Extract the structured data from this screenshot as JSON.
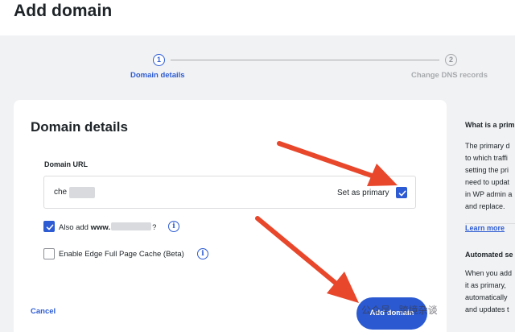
{
  "page": {
    "title": "Add domain"
  },
  "stepper": {
    "steps": [
      {
        "number": "1",
        "label": "Domain details"
      },
      {
        "number": "2",
        "label": "Change DNS records"
      }
    ]
  },
  "form": {
    "title": "Domain details",
    "url_label": "Domain URL",
    "url_value": "che",
    "primary_label": "Set as primary",
    "www_prefix": "Also add ",
    "www_bold": "www.",
    "www_suffix": "?",
    "cache_label": "Enable Edge Full Page Cache (Beta)",
    "info_glyph": "i",
    "cancel_label": "Cancel",
    "add_button_label": "Add domain"
  },
  "sidebar": {
    "heading1": "What is a prim",
    "para1": [
      "The primary d",
      "to which traffi",
      "setting the pri",
      "need to updat",
      "in WP admin a",
      "and replace."
    ],
    "learn_more": "Learn more",
    "heading2": "Automated se",
    "para2": [
      "When you add",
      "it as primary,",
      "automatically",
      "and updates t"
    ]
  },
  "watermark": "公众号 · 跨境杂谈",
  "colors": {
    "accent": "#2c5bd3",
    "arrow": "#e8472b",
    "page_bg": "#f1f2f4"
  }
}
